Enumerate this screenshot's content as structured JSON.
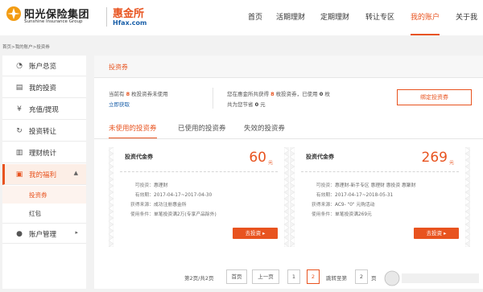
{
  "brand": {
    "name_cn": "阳光保险集团",
    "name_en": "Sunshine Insurance Group",
    "partner_cn": "惠金所",
    "partner_en": "Hfax.com"
  },
  "nav": [
    "首页",
    "活期理财",
    "定期理财",
    "转让专区",
    "我的账户",
    "关于我"
  ],
  "nav_active": "我的账户",
  "breadcrumb": "首页>我的账户>投资券",
  "sidebar": {
    "items": [
      {
        "icon": "pie-chart-icon",
        "label": "账户总览"
      },
      {
        "icon": "document-icon",
        "label": "我的投资"
      },
      {
        "icon": "yen-icon",
        "label": "充值/提现"
      },
      {
        "icon": "refresh-icon",
        "label": "投资转让"
      },
      {
        "icon": "bar-chart-icon",
        "label": "理财统计"
      },
      {
        "icon": "gift-icon",
        "label": "我的福利"
      },
      {
        "icon": "user-icon",
        "label": "账户管理"
      }
    ],
    "welfare_sub": [
      "投资券",
      "红包"
    ]
  },
  "main": {
    "title": "投资券",
    "summary": {
      "unused_pre": "当前有 ",
      "unused_count": "8",
      "unused_post": " 枚投资券未使用",
      "redeem_link": "立即获取",
      "received_pre": "您在惠金所共获得 ",
      "received_count": "8",
      "received_mid": " 枚投资券，已使用 ",
      "used_count": "0",
      "received_post": " 枚",
      "saved_pre": "共为您节省 ",
      "saved_amount": "0",
      "saved_post": " 元"
    },
    "bind_button": "绑定投资券",
    "tabs": [
      "未使用的投资券",
      "已使用的投资券",
      "失效的投资券"
    ],
    "coupons": [
      {
        "title": "投资代金券",
        "amount": "60",
        "unit": "元",
        "rows": [
          {
            "k": "可投资：",
            "v": "惠理财"
          },
          {
            "k": "有效期：",
            "v": "2017-04-17~2017-04-30"
          },
          {
            "k": "获得来源：",
            "v": "成功注册惠金所"
          },
          {
            "k": "使用条件：",
            "v": "单笔投资满2万(专享产品除外)"
          }
        ],
        "button": "去投资 ▸"
      },
      {
        "title": "投资代金券",
        "amount": "269",
        "unit": "元",
        "rows": [
          {
            "k": "可投资：",
            "v": "惠理财-新手专区 惠理财 惠投资 惠聚财"
          },
          {
            "k": "有效期：",
            "v": "2017-04-17~2018-05-31"
          },
          {
            "k": "获得来源：",
            "v": "AC9- \"0\" 元购活动"
          },
          {
            "k": "使用条件：",
            "v": "单笔投资满269元"
          }
        ],
        "button": "去投资 ▸"
      }
    ],
    "pager": {
      "info": "第2页/共2页",
      "first": "首页",
      "prev": "上一页",
      "pages": [
        "1",
        "2"
      ],
      "current": "2",
      "jump_label": "跳转至第",
      "jump_value": "2",
      "jump_unit": "页"
    }
  },
  "colors": {
    "accent": "#e8531f",
    "link": "#1a5fa8"
  }
}
